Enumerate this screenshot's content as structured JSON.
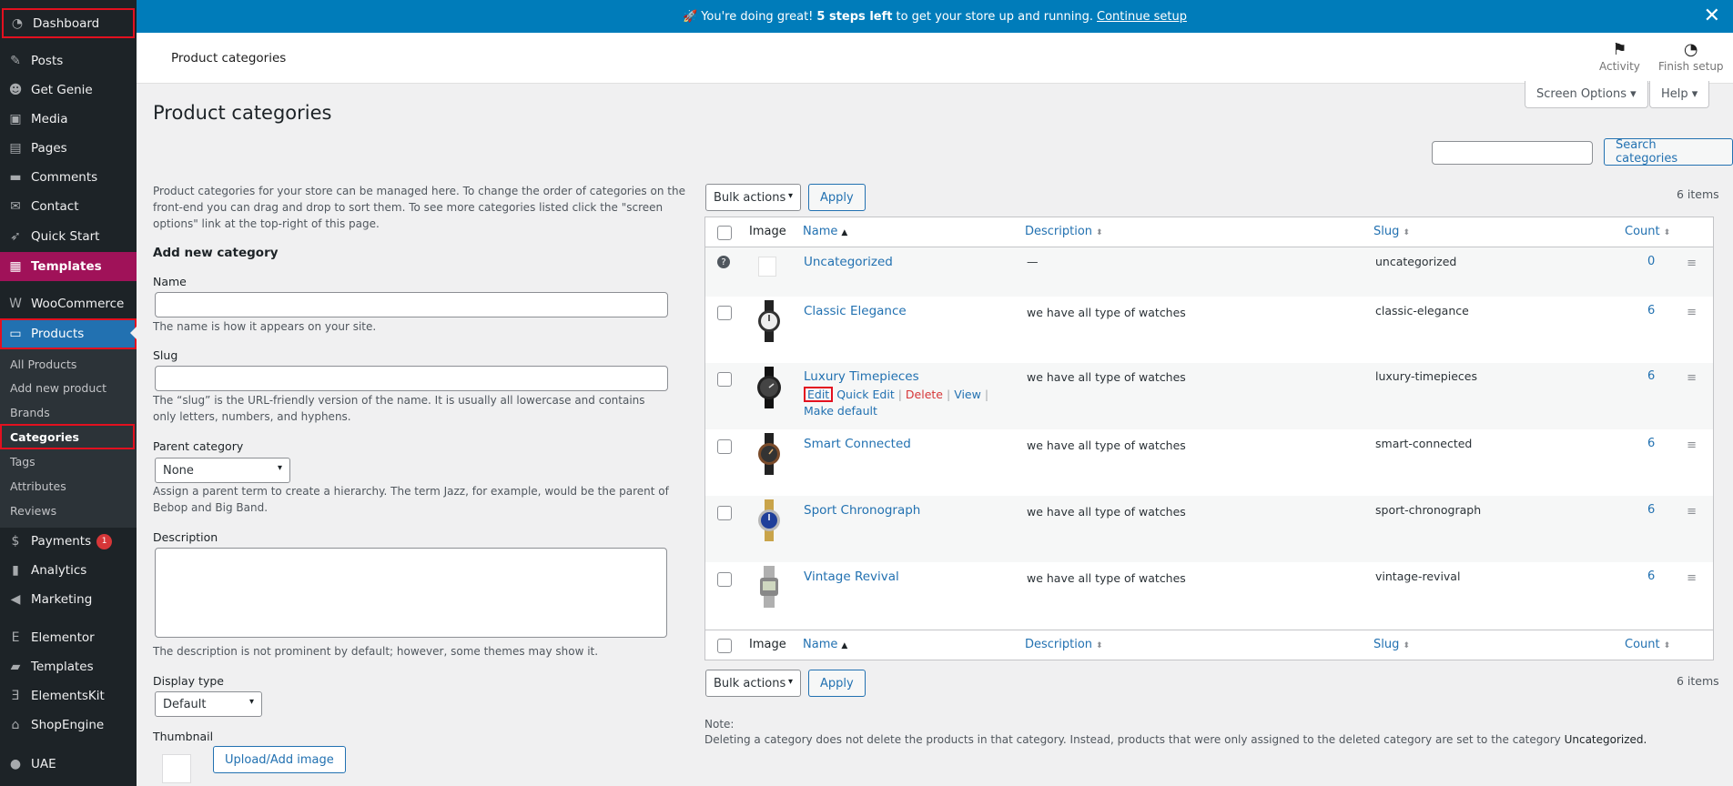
{
  "sidebar": {
    "items": [
      {
        "label": "Dashboard",
        "icon": "dashboard-icon"
      },
      {
        "label": "Posts",
        "icon": "pin-icon"
      },
      {
        "label": "Get Genie",
        "icon": "genie-icon"
      },
      {
        "label": "Media",
        "icon": "media-icon"
      },
      {
        "label": "Pages",
        "icon": "pages-icon"
      },
      {
        "label": "Comments",
        "icon": "comment-icon"
      },
      {
        "label": "Contact",
        "icon": "mail-icon"
      },
      {
        "label": "Quick Start",
        "icon": "rocket-icon"
      },
      {
        "label": "Templates",
        "icon": "templates-icon"
      },
      {
        "label": "WooCommerce",
        "icon": "woo-icon"
      },
      {
        "label": "Products",
        "icon": "archive-icon"
      },
      {
        "label": "Payments",
        "icon": "dollar-icon",
        "badge": "1"
      },
      {
        "label": "Analytics",
        "icon": "chart-icon"
      },
      {
        "label": "Marketing",
        "icon": "megaphone-icon"
      },
      {
        "label": "Elementor",
        "icon": "elementor-icon"
      },
      {
        "label": "Templates",
        "icon": "folder-icon"
      },
      {
        "label": "ElementsKit",
        "icon": "elementskit-icon"
      },
      {
        "label": "ShopEngine",
        "icon": "shop-icon"
      },
      {
        "label": "UAE",
        "icon": "uae-icon"
      }
    ],
    "submenu": [
      "All Products",
      "Add new product",
      "Brands",
      "Categories",
      "Tags",
      "Attributes",
      "Reviews"
    ]
  },
  "notice": {
    "emoji": "🚀",
    "pre": "You're doing great!",
    "bold": "5 steps left",
    "post": "to get your store up and running.",
    "link": "Continue setup",
    "close": "✕"
  },
  "header": {
    "title": "Product categories",
    "activity": "Activity",
    "finish_setup": "Finish setup"
  },
  "page": {
    "title": "Product categories",
    "screen_options": "Screen Options ▾",
    "help": "Help ▾",
    "search_button": "Search categories",
    "search_value": ""
  },
  "form": {
    "intro": "Product categories for your store can be managed here. To change the order of categories on the front-end you can drag and drop to sort them. To see more categories listed click the \"screen options\" link at the top-right of this page.",
    "heading": "Add new category",
    "name_label": "Name",
    "name_help": "The name is how it appears on your site.",
    "slug_label": "Slug",
    "slug_help": "The “slug” is the URL-friendly version of the name. It is usually all lowercase and contains only letters, numbers, and hyphens.",
    "parent_label": "Parent category",
    "parent_value": "None",
    "parent_help": "Assign a parent term to create a hierarchy. The term Jazz, for example, would be the parent of Bebop and Big Band.",
    "description_label": "Description",
    "description_help": "The description is not prominent by default; however, some themes may show it.",
    "display_type_label": "Display type",
    "display_type_value": "Default",
    "thumbnail_label": "Thumbnail",
    "upload_button": "Upload/Add image"
  },
  "table": {
    "bulk_actions": "Bulk actions",
    "apply": "Apply",
    "items_count": "6 items",
    "columns": {
      "image": "Image",
      "name": "Name",
      "description": "Description",
      "slug": "Slug",
      "count": "Count"
    },
    "rows": [
      {
        "name": "Uncategorized",
        "description": "—",
        "slug": "uncategorized",
        "count": "0"
      },
      {
        "name": "Classic Elegance",
        "description": "we have all type of watches",
        "slug": "classic-elegance",
        "count": "6"
      },
      {
        "name": "Luxury Timepieces",
        "description": "we have all type of watches",
        "slug": "luxury-timepieces",
        "count": "6"
      },
      {
        "name": "Smart Connected",
        "description": "we have all type of watches",
        "slug": "smart-connected",
        "count": "6"
      },
      {
        "name": "Sport Chronograph",
        "description": "we have all type of watches",
        "slug": "sport-chronograph",
        "count": "6"
      },
      {
        "name": "Vintage Revival",
        "description": "we have all type of watches",
        "slug": "vintage-revival",
        "count": "6"
      }
    ],
    "row_actions": {
      "edit": "Edit",
      "quick_edit": "Quick Edit",
      "delete": "Delete",
      "view": "View",
      "make_default": "Make default"
    },
    "note_label": "Note:",
    "note_text": "Deleting a category does not delete the products in that category. Instead, products that were only assigned to the deleted category are set to the category",
    "note_bold": "Uncategorized."
  },
  "colors": {
    "sidebar_bg": "#1d2327",
    "accent": "#2271b1",
    "notice_bg": "#007cba",
    "templates_hl": "#a01259",
    "highlight_box": "#e3101f"
  }
}
